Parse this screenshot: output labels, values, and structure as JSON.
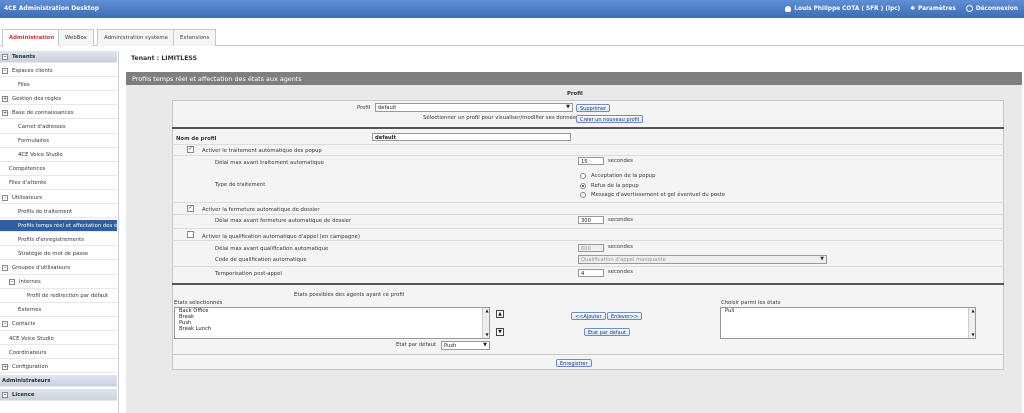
{
  "app": {
    "title": "4CE Administration Desktop"
  },
  "topbar": {
    "user": "Louis Philippe COTA ( SFR ) (lpc)",
    "settings": "Paramètres",
    "logout": "Déconnexion"
  },
  "tabs": [
    "Administration",
    "WebBox",
    "Administration système",
    "Extensions"
  ],
  "sidebar": [
    {
      "label": "Tenants",
      "type": "header",
      "pm": "–"
    },
    {
      "label": "Espaces clients",
      "type": "group",
      "pm": "–"
    },
    {
      "label": "Files",
      "type": "item"
    },
    {
      "label": "Gestion des règles",
      "type": "group",
      "pm": "+"
    },
    {
      "label": "Base de connaissances",
      "type": "group",
      "pm": "+"
    },
    {
      "label": "Carnet d'adresses",
      "type": "item"
    },
    {
      "label": "Formulaires",
      "type": "item"
    },
    {
      "label": "4CE Voice Studio",
      "type": "item"
    },
    {
      "label": "Compétences",
      "type": "plain"
    },
    {
      "label": "Files d'attente",
      "type": "plain"
    },
    {
      "label": "Utilisateurs",
      "type": "group",
      "pm": "–"
    },
    {
      "label": "Profils de traitement",
      "type": "item"
    },
    {
      "label": "Profils temps réel et affectation des é",
      "type": "selected"
    },
    {
      "label": "Profils d'enregistrements",
      "type": "item"
    },
    {
      "label": "Stratégie de mot de passe",
      "type": "item"
    },
    {
      "label": "Groupes d'utilisateurs",
      "type": "group",
      "pm": "–"
    },
    {
      "label": "Internes",
      "type": "subgroup",
      "pm": "–"
    },
    {
      "label": "Profil de redirection par défaut",
      "type": "subitem"
    },
    {
      "label": "Externes",
      "type": "item"
    },
    {
      "label": "Contacts",
      "type": "group",
      "pm": "–"
    },
    {
      "label": "4CE Voice Studio",
      "type": "plain"
    },
    {
      "label": "Coordinateurs",
      "type": "plain"
    },
    {
      "label": "Configuration",
      "type": "group",
      "pm": "+"
    },
    {
      "label": "Administrateurs",
      "type": "header"
    },
    {
      "label": "Licence",
      "type": "header",
      "pm": "–"
    }
  ],
  "main": {
    "tenant_label": "Tenant :",
    "tenant_value": "LIMITLESS",
    "panel_title": "Profils temps réel et affectation des états aux agents",
    "section_title": "Profil",
    "profil_label": "Profil",
    "profil_value": "default",
    "btn_delete": "Supprimer",
    "profil_hint": "Sélectionner un profil pour visualiser/modifier ses données",
    "btn_new": "Créer un nouveau profil",
    "name_label": "Nom de profil",
    "name_value": "default",
    "popup_check": "Activer le traitement automatique des popup",
    "popup_checked": true,
    "delay_label": "Délai max avant traitement automatique",
    "delay_value": "15",
    "seconds": "secondes",
    "type_label": "Type de traitement",
    "type_options": [
      "Acceptation de la popup",
      "Refus de la popup",
      "Message d'avertissement et gel éventuel du poste"
    ],
    "type_selected": 1,
    "close_check": "Activer la fermeture automatique de dossier",
    "close_checked": true,
    "close_delay_label": "Délai max avant fermeture automatique de dossier",
    "close_delay_value": "300",
    "qual_check": "Activer la qualification automatique d'appel (en campagne)",
    "qual_checked": false,
    "qual_delay_label": "Délai max avant qualification automatique",
    "qual_delay_value": "600",
    "qual_code_label": "Code de qualification automatique",
    "qual_code_value": "Qualification d'appel manquante",
    "temp_label": "Temporisation post-appel",
    "temp_value": "4",
    "states_title": "Etats possibles des agents ayant ce profil",
    "selected_label": "Etats sélectionnés",
    "selected_states": [
      "Back Office",
      "Break",
      "Push",
      "Break Lunch"
    ],
    "btn_add": "<<Ajouter",
    "btn_remove": "Enlever>>",
    "btn_default": "Etat par défaut",
    "choose_label": "Choisir parmi les états",
    "available_states": [
      "Pull"
    ],
    "default_label": "Etat par défaut",
    "default_value": "Push",
    "btn_save": "Enregistrer"
  }
}
